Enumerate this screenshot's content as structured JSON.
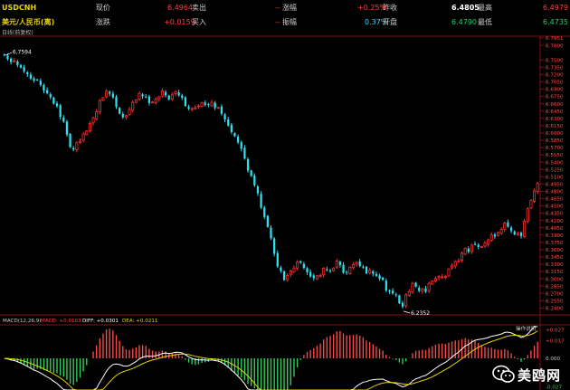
{
  "header": {
    "symbol": "USDCNH",
    "name": "美元/人民币(离)",
    "period_label": "日线(前复权)",
    "row1": [
      {
        "label": "现价",
        "value": "6.4964"
      },
      {
        "label": "卖出",
        "value": "--"
      },
      {
        "label": "涨幅",
        "value": "+0.25%"
      },
      {
        "label": "昨收",
        "value": "6.4805"
      },
      {
        "label": "最高",
        "value": "6.4979"
      }
    ],
    "row2": [
      {
        "label": "涨跌",
        "value": "+0.0159"
      },
      {
        "label": "买入",
        "value": "--"
      },
      {
        "label": "振幅",
        "value": "0.37%"
      },
      {
        "label": "开盘",
        "value": "6.4790"
      },
      {
        "label": "最低",
        "value": "6.4735"
      }
    ]
  },
  "watermark": {
    "text": "美鸥网",
    "icon": "wechat-icon"
  },
  "chart_data": [
    {
      "type": "candlestick",
      "title": "",
      "y_axis": {
        "position": "right",
        "ticks": [
          6.7951,
          6.78,
          6.75,
          6.735,
          6.72,
          6.705,
          6.69,
          6.675,
          6.66,
          6.645,
          6.63,
          6.615,
          6.6,
          6.585,
          6.57,
          6.555,
          6.54,
          6.525,
          6.51,
          6.495,
          6.48,
          6.465,
          6.45,
          6.435,
          6.42,
          6.405,
          6.39,
          6.375,
          6.36,
          6.345,
          6.33,
          6.315,
          6.3,
          6.285,
          6.27,
          6.255,
          6.24
        ],
        "ylim": [
          6.235,
          6.7951
        ]
      },
      "annotations": [
        {
          "label": "6.7594",
          "value": 6.7594,
          "index": 0
        },
        {
          "label": "6.2352",
          "value": 6.2352,
          "index": 121
        }
      ],
      "colors": {
        "up": "#ff2d2d",
        "down": "#2ee0f0"
      },
      "series": [
        {
          "name": "",
          "closes": [
            6.7594,
            6.752,
            6.7458,
            6.7481,
            6.7396,
            6.7342,
            6.7265,
            6.7205,
            6.7114,
            6.7075,
            6.7087,
            6.6986,
            6.6868,
            6.6817,
            6.6734,
            6.6599,
            6.6549,
            6.6327,
            6.6232,
            6.5966,
            6.5707,
            6.5658,
            6.5797,
            6.5828,
            6.5978,
            6.6038,
            6.6192,
            6.6309,
            6.6435,
            6.6665,
            6.6722,
            6.6858,
            6.6807,
            6.6729,
            6.6536,
            6.6397,
            6.6321,
            6.6355,
            6.648,
            6.6628,
            6.6677,
            6.6811,
            6.6753,
            6.6741,
            6.6613,
            6.6635,
            6.6691,
            6.674,
            6.6863,
            6.6774,
            6.6687,
            6.6783,
            6.6847,
            6.6771,
            6.6721,
            6.6555,
            6.6498,
            6.65,
            6.6516,
            6.6556,
            6.6622,
            6.6576,
            6.6579,
            6.6629,
            6.6512,
            6.6521,
            6.6393,
            6.6275,
            6.6153,
            6.6016,
            6.5931,
            6.5804,
            6.5674,
            6.5474,
            6.5226,
            6.5112,
            6.4921,
            6.4755,
            6.446,
            6.4272,
            6.4068,
            6.383,
            6.3513,
            6.3252,
            6.3162,
            6.2974,
            6.3068,
            6.3161,
            6.322,
            6.3346,
            6.3325,
            6.3225,
            6.3133,
            6.3048,
            6.3012,
            6.3062,
            6.3067,
            6.3215,
            6.3179,
            6.3159,
            6.3221,
            6.3364,
            6.3285,
            6.3124,
            6.3125,
            6.3238,
            6.3292,
            6.3337,
            6.3262,
            6.3246,
            6.3111,
            6.3175,
            6.3102,
            6.3061,
            6.3002,
            6.2976,
            6.2758,
            6.2741,
            6.27,
            6.2665,
            6.2495,
            6.2425,
            6.2671,
            6.2733,
            6.2904,
            6.2838,
            6.2752,
            6.2792,
            6.2732,
            6.2903,
            6.2951,
            6.3006,
            6.3047,
            6.304,
            6.3048,
            6.3201,
            6.3277,
            6.3354,
            6.3369,
            6.3525,
            6.3627,
            6.3552,
            6.3693,
            6.3711,
            6.3653,
            6.3659,
            6.3731,
            6.3798,
            6.3902,
            6.3869,
            6.3951,
            6.4015,
            6.4147,
            6.4073,
            6.3983,
            6.391,
            6.3928,
            6.3879,
            6.4183,
            6.4438,
            6.4614,
            6.4805,
            6.4964
          ]
        }
      ]
    },
    {
      "type": "line",
      "title": "MACD(12,26,9)",
      "legend": [
        {
          "label": "MACD: +0.0103",
          "color": "#ff4a4a"
        },
        {
          "label": "DIFF: +0.0301",
          "color": "#ffffff"
        },
        {
          "label": "DEA: +0.0211",
          "color": "#e8d200"
        }
      ],
      "y_axis": {
        "ticks": [
          "+0.027",
          "+0.017",
          "0.000",
          "-0.027"
        ],
        "ylim": [
          -0.03,
          0.03
        ]
      },
      "series": [
        {
          "name": "DIFF",
          "color": "#ffffff"
        },
        {
          "name": "DEA",
          "color": "#e8d200"
        },
        {
          "name": "MACD",
          "color": "#ff4a4a",
          "negative_color": "#2fd45a"
        }
      ]
    }
  ],
  "right_tag": "操作说明"
}
